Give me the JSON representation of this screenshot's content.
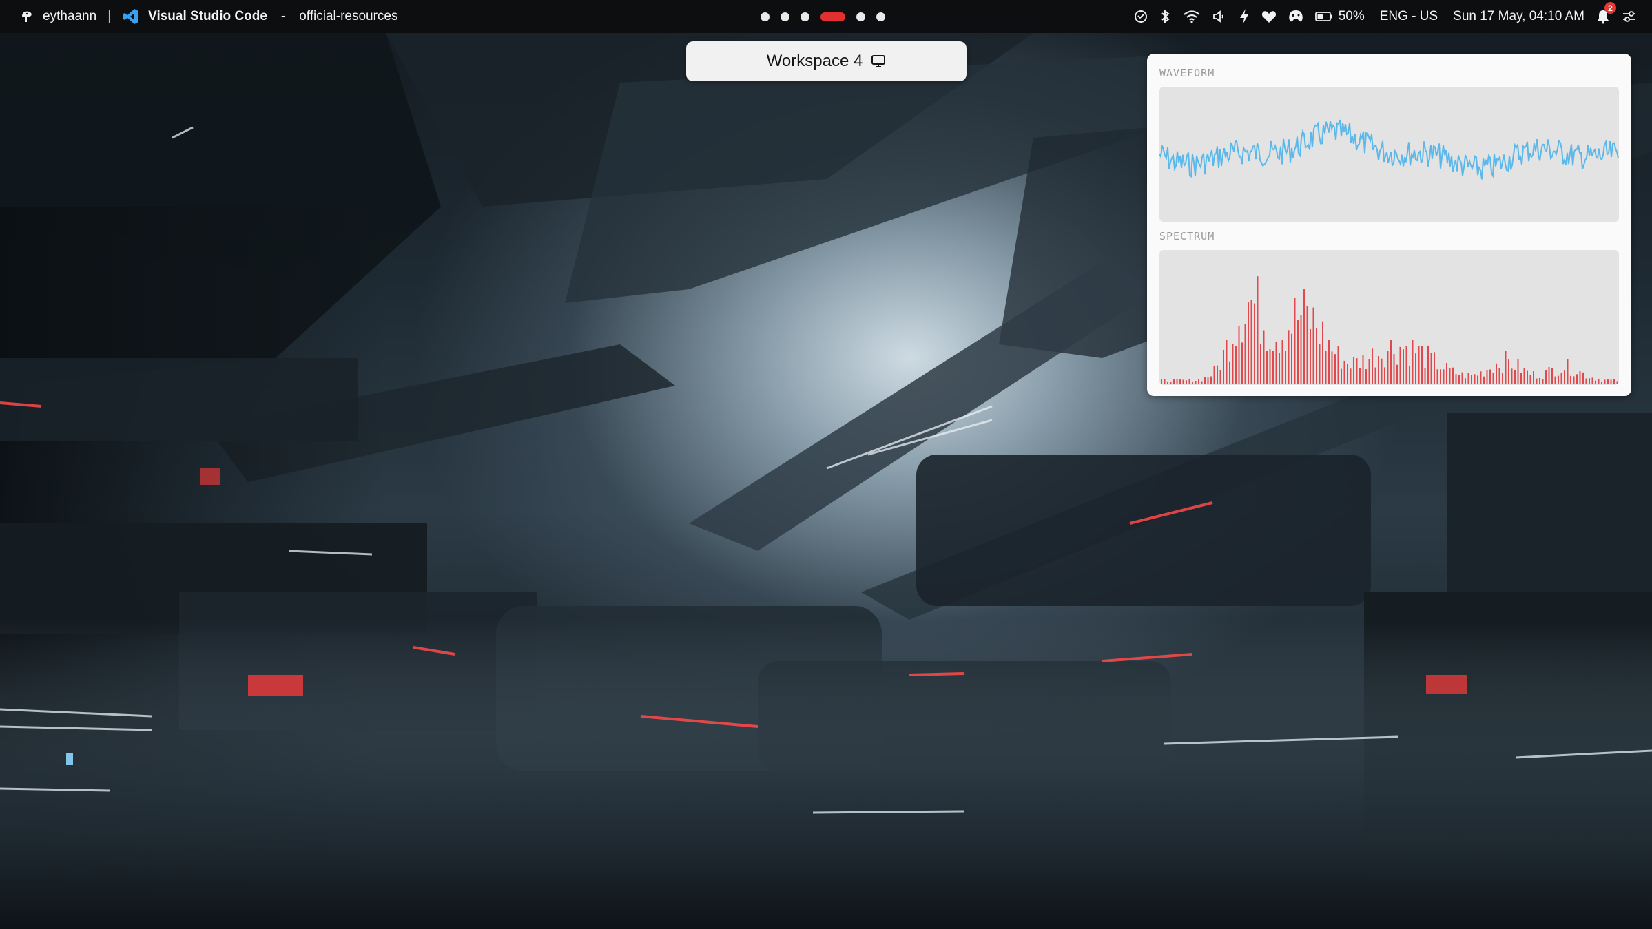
{
  "topbar": {
    "user": "eythaann",
    "app_name": "Visual Studio Code",
    "separator": "-",
    "window_title": "official-resources",
    "workspaces": [
      {
        "icon": "dot",
        "active": false
      },
      {
        "icon": "dot",
        "active": false
      },
      {
        "icon": "dot",
        "active": false
      },
      {
        "icon": "pill",
        "active": true
      },
      {
        "icon": "dot",
        "active": false
      },
      {
        "icon": "dot",
        "active": false
      }
    ],
    "battery": "50%",
    "language": "ENG - US",
    "datetime": "Sun 17 May, 04:10 AM",
    "notifications": "2"
  },
  "workspace_popup": {
    "label": "Workspace 4",
    "icon": "monitor-icon"
  },
  "visualizer": {
    "waveform_label": "WAVEFORM",
    "spectrum_label": "SPECTRUM",
    "waveform_color": "#5bb8ea",
    "spectrum_color": "#e0484c"
  },
  "colors": {
    "bar_bg": "#0c0e10",
    "accent_active": "#e03030",
    "badge": "#e53935"
  }
}
